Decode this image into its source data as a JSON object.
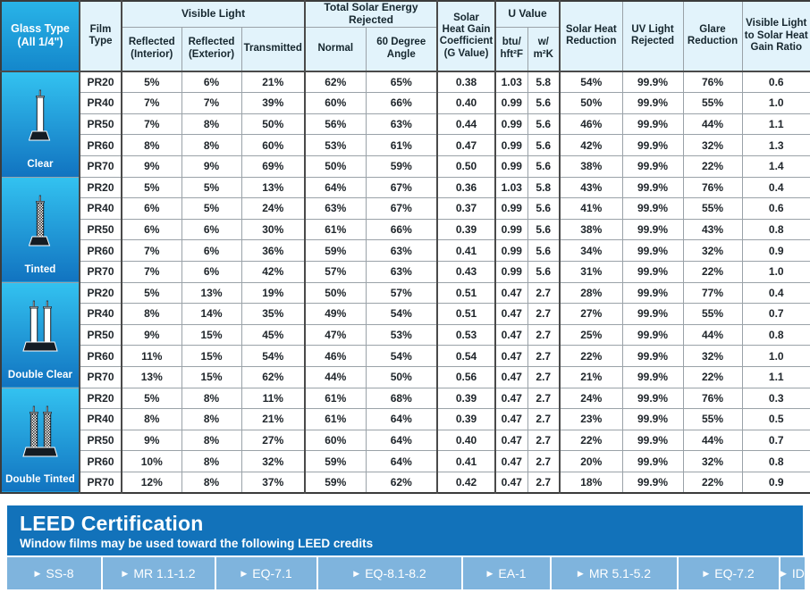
{
  "table": {
    "corner_header": {
      "line1": "Glass Type",
      "line2": "(All 1/4\")"
    },
    "column_groups": [
      {
        "label": "Visible Light",
        "span": 3
      },
      {
        "label": "Total Solar Energy Rejected",
        "span": 2
      },
      {
        "label": "U Value",
        "span": 2
      }
    ],
    "headers": {
      "film_type": "Film\nType",
      "film_type_l1": "Film",
      "film_type_l2": "Type",
      "vl_reflected_interior_l1": "Reflected",
      "vl_reflected_interior_l2": "(Interior)",
      "vl_reflected_exterior_l1": "Reflected",
      "vl_reflected_exterior_l2": "(Exterior)",
      "vl_transmitted": "Transmitted",
      "tser_normal": "Normal",
      "tser_60_l1": "60 Degree",
      "tser_60_l2": "Angle",
      "shgc_l1": "Solar",
      "shgc_l2": "Heat Gain",
      "shgc_l3": "Coefficient",
      "shgc_l4": "(G Value)",
      "uvalue_group": "U Value",
      "uvalue_btu_l1": "btu/",
      "uvalue_btu_l2": "hft²F",
      "uvalue_w_l1": "w/",
      "uvalue_w_l2": "m²K",
      "solar_heat_reduction_l1": "Solar Heat",
      "solar_heat_reduction_l2": "Reduction",
      "uv_light_rejected_l1": "UV Light",
      "uv_light_rejected_l2": "Rejected",
      "glare_reduction_l1": "Glare",
      "glare_reduction_l2": "Reduction",
      "vl_shg_ratio_l1": "Visible Light",
      "vl_shg_ratio_l2": "to Solar Heat",
      "vl_shg_ratio_l3": "Gain Ratio"
    },
    "groups": [
      {
        "name": "Clear",
        "icon": "single-pane-clear-icon",
        "rows": [
          {
            "film": "PR20",
            "vl_ri": "5%",
            "vl_re": "6%",
            "vl_t": "21%",
            "tser_n": "62%",
            "tser_60": "65%",
            "shgc": "0.38",
            "u_btu": "1.03",
            "u_w": "5.8",
            "shr": "54%",
            "uvr": "99.9%",
            "gr": "76%",
            "ratio": "0.6"
          },
          {
            "film": "PR40",
            "vl_ri": "7%",
            "vl_re": "7%",
            "vl_t": "39%",
            "tser_n": "60%",
            "tser_60": "66%",
            "shgc": "0.40",
            "u_btu": "0.99",
            "u_w": "5.6",
            "shr": "50%",
            "uvr": "99.9%",
            "gr": "55%",
            "ratio": "1.0"
          },
          {
            "film": "PR50",
            "vl_ri": "7%",
            "vl_re": "8%",
            "vl_t": "50%",
            "tser_n": "56%",
            "tser_60": "63%",
            "shgc": "0.44",
            "u_btu": "0.99",
            "u_w": "5.6",
            "shr": "46%",
            "uvr": "99.9%",
            "gr": "44%",
            "ratio": "1.1"
          },
          {
            "film": "PR60",
            "vl_ri": "8%",
            "vl_re": "8%",
            "vl_t": "60%",
            "tser_n": "53%",
            "tser_60": "61%",
            "shgc": "0.47",
            "u_btu": "0.99",
            "u_w": "5.6",
            "shr": "42%",
            "uvr": "99.9%",
            "gr": "32%",
            "ratio": "1.3"
          },
          {
            "film": "PR70",
            "vl_ri": "9%",
            "vl_re": "9%",
            "vl_t": "69%",
            "tser_n": "50%",
            "tser_60": "59%",
            "shgc": "0.50",
            "u_btu": "0.99",
            "u_w": "5.6",
            "shr": "38%",
            "uvr": "99.9%",
            "gr": "22%",
            "ratio": "1.4"
          }
        ]
      },
      {
        "name": "Tinted",
        "icon": "single-pane-tinted-icon",
        "rows": [
          {
            "film": "PR20",
            "vl_ri": "5%",
            "vl_re": "5%",
            "vl_t": "13%",
            "tser_n": "64%",
            "tser_60": "67%",
            "shgc": "0.36",
            "u_btu": "1.03",
            "u_w": "5.8",
            "shr": "43%",
            "uvr": "99.9%",
            "gr": "76%",
            "ratio": "0.4"
          },
          {
            "film": "PR40",
            "vl_ri": "6%",
            "vl_re": "5%",
            "vl_t": "24%",
            "tser_n": "63%",
            "tser_60": "67%",
            "shgc": "0.37",
            "u_btu": "0.99",
            "u_w": "5.6",
            "shr": "41%",
            "uvr": "99.9%",
            "gr": "55%",
            "ratio": "0.6"
          },
          {
            "film": "PR50",
            "vl_ri": "6%",
            "vl_re": "6%",
            "vl_t": "30%",
            "tser_n": "61%",
            "tser_60": "66%",
            "shgc": "0.39",
            "u_btu": "0.99",
            "u_w": "5.6",
            "shr": "38%",
            "uvr": "99.9%",
            "gr": "43%",
            "ratio": "0.8"
          },
          {
            "film": "PR60",
            "vl_ri": "7%",
            "vl_re": "6%",
            "vl_t": "36%",
            "tser_n": "59%",
            "tser_60": "63%",
            "shgc": "0.41",
            "u_btu": "0.99",
            "u_w": "5.6",
            "shr": "34%",
            "uvr": "99.9%",
            "gr": "32%",
            "ratio": "0.9"
          },
          {
            "film": "PR70",
            "vl_ri": "7%",
            "vl_re": "6%",
            "vl_t": "42%",
            "tser_n": "57%",
            "tser_60": "63%",
            "shgc": "0.43",
            "u_btu": "0.99",
            "u_w": "5.6",
            "shr": "31%",
            "uvr": "99.9%",
            "gr": "22%",
            "ratio": "1.0"
          }
        ]
      },
      {
        "name": "Double Clear",
        "icon": "double-pane-clear-icon",
        "rows": [
          {
            "film": "PR20",
            "vl_ri": "5%",
            "vl_re": "13%",
            "vl_t": "19%",
            "tser_n": "50%",
            "tser_60": "57%",
            "shgc": "0.51",
            "u_btu": "0.47",
            "u_w": "2.7",
            "shr": "28%",
            "uvr": "99.9%",
            "gr": "77%",
            "ratio": "0.4"
          },
          {
            "film": "PR40",
            "vl_ri": "8%",
            "vl_re": "14%",
            "vl_t": "35%",
            "tser_n": "49%",
            "tser_60": "54%",
            "shgc": "0.51",
            "u_btu": "0.47",
            "u_w": "2.7",
            "shr": "27%",
            "uvr": "99.9%",
            "gr": "55%",
            "ratio": "0.7"
          },
          {
            "film": "PR50",
            "vl_ri": "9%",
            "vl_re": "15%",
            "vl_t": "45%",
            "tser_n": "47%",
            "tser_60": "53%",
            "shgc": "0.53",
            "u_btu": "0.47",
            "u_w": "2.7",
            "shr": "25%",
            "uvr": "99.9%",
            "gr": "44%",
            "ratio": "0.8"
          },
          {
            "film": "PR60",
            "vl_ri": "11%",
            "vl_re": "15%",
            "vl_t": "54%",
            "tser_n": "46%",
            "tser_60": "54%",
            "shgc": "0.54",
            "u_btu": "0.47",
            "u_w": "2.7",
            "shr": "22%",
            "uvr": "99.9%",
            "gr": "32%",
            "ratio": "1.0"
          },
          {
            "film": "PR70",
            "vl_ri": "13%",
            "vl_re": "15%",
            "vl_t": "62%",
            "tser_n": "44%",
            "tser_60": "50%",
            "shgc": "0.56",
            "u_btu": "0.47",
            "u_w": "2.7",
            "shr": "21%",
            "uvr": "99.9%",
            "gr": "22%",
            "ratio": "1.1"
          }
        ]
      },
      {
        "name": "Double Tinted",
        "icon": "double-pane-tinted-icon",
        "rows": [
          {
            "film": "PR20",
            "vl_ri": "5%",
            "vl_re": "8%",
            "vl_t": "11%",
            "tser_n": "61%",
            "tser_60": "68%",
            "shgc": "0.39",
            "u_btu": "0.47",
            "u_w": "2.7",
            "shr": "24%",
            "uvr": "99.9%",
            "gr": "76%",
            "ratio": "0.3"
          },
          {
            "film": "PR40",
            "vl_ri": "8%",
            "vl_re": "8%",
            "vl_t": "21%",
            "tser_n": "61%",
            "tser_60": "64%",
            "shgc": "0.39",
            "u_btu": "0.47",
            "u_w": "2.7",
            "shr": "23%",
            "uvr": "99.9%",
            "gr": "55%",
            "ratio": "0.5"
          },
          {
            "film": "PR50",
            "vl_ri": "9%",
            "vl_re": "8%",
            "vl_t": "27%",
            "tser_n": "60%",
            "tser_60": "64%",
            "shgc": "0.40",
            "u_btu": "0.47",
            "u_w": "2.7",
            "shr": "22%",
            "uvr": "99.9%",
            "gr": "44%",
            "ratio": "0.7"
          },
          {
            "film": "PR60",
            "vl_ri": "10%",
            "vl_re": "8%",
            "vl_t": "32%",
            "tser_n": "59%",
            "tser_60": "64%",
            "shgc": "0.41",
            "u_btu": "0.47",
            "u_w": "2.7",
            "shr": "20%",
            "uvr": "99.9%",
            "gr": "32%",
            "ratio": "0.8"
          },
          {
            "film": "PR70",
            "vl_ri": "12%",
            "vl_re": "8%",
            "vl_t": "37%",
            "tser_n": "59%",
            "tser_60": "62%",
            "shgc": "0.42",
            "u_btu": "0.47",
            "u_w": "2.7",
            "shr": "18%",
            "uvr": "99.9%",
            "gr": "22%",
            "ratio": "0.9"
          }
        ]
      }
    ]
  },
  "leed": {
    "title": "LEED Certification",
    "subtitle": "Window films may be used toward the following LEED credits",
    "credits": [
      "SS-8",
      "MR 1.1-1.2",
      "EQ-7.1",
      "EQ-8.1-8.2",
      "EA-1",
      "MR 5.1-5.2",
      "EQ-7.2",
      "ID"
    ]
  },
  "colors": {
    "header_bg": "#e2f3fb",
    "glass_blue_top": "#33c2f0",
    "glass_blue_bottom": "#1173c0",
    "leed_header_bg": "#1272ba",
    "leed_credit_bg": "#7fb4dd",
    "border": "#9aa2a8",
    "border_strong": "#4a4a4a"
  }
}
